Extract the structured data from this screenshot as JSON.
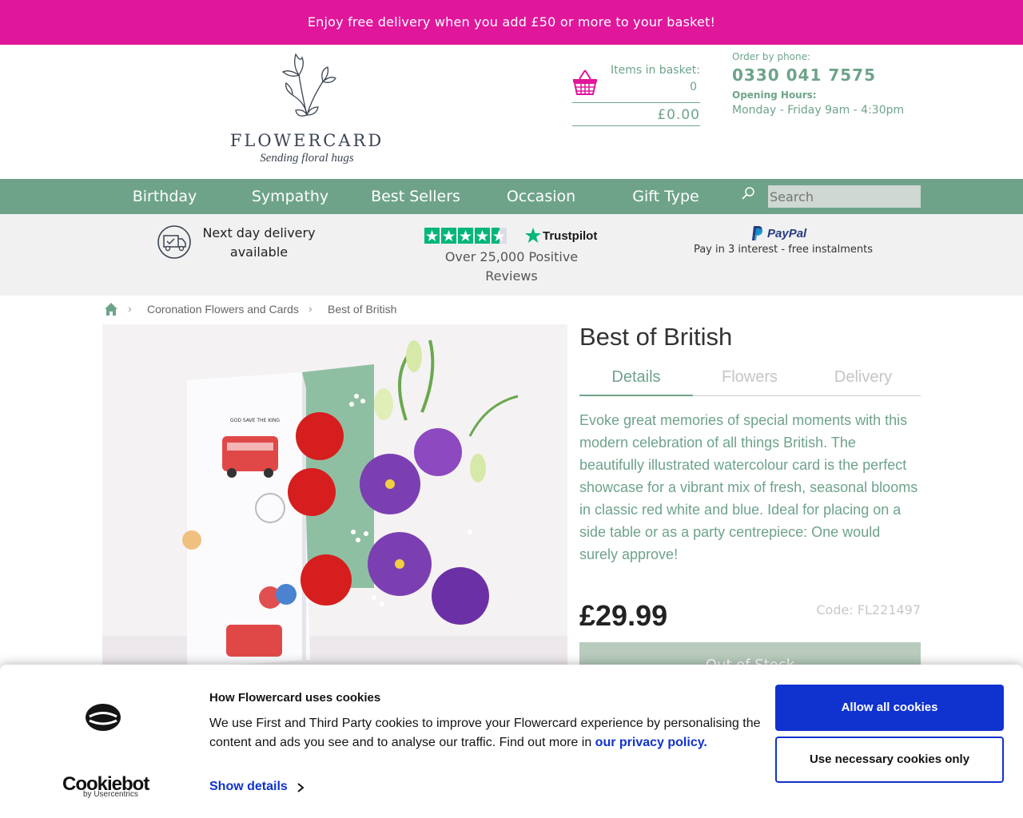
{
  "promo_bar": {
    "text": "Enjoy free delivery when you add £50 or more to your basket!"
  },
  "logo": {
    "brand": "FLOWERCARD",
    "tagline": "Sending floral hugs"
  },
  "basket": {
    "label": "Items in basket:",
    "count": "0",
    "total": "£0.00"
  },
  "contact": {
    "order_label": "Order by phone:",
    "phone": "0330 041 7575",
    "hours_label": "Opening Hours:",
    "hours": "Monday - Friday 9am - 4:30pm"
  },
  "nav": {
    "items": [
      "Birthday",
      "Sympathy",
      "Best Sellers",
      "Occasion",
      "Gift Type"
    ],
    "search_placeholder": "Search"
  },
  "trust": {
    "delivery": "Next day delivery available",
    "trustpilot_brand": "Trustpilot",
    "reviews": "Over 25,000 Positive Reviews",
    "paypal_brand": "PayPal",
    "paypal_text": "Pay in 3 interest - free instalments"
  },
  "breadcrumb": {
    "items": [
      "Coronation Flowers and Cards",
      "Best of British"
    ]
  },
  "product": {
    "title": "Best of British",
    "tabs": [
      "Details",
      "Flowers",
      "Delivery"
    ],
    "description": "Evoke great memories of special moments with this modern celebration of all things British. The beautifully illustrated watercolour card is the perfect showcase for a vibrant mix of fresh, seasonal blooms in classic red white and blue. Ideal for placing on a side table or as a party centrepiece: One would surely approve!",
    "price": "£29.99",
    "code": "Code: FL221497",
    "stock_button": "Out of Stock",
    "card_text": "GOD SAVE THE KING"
  },
  "cookie_banner": {
    "title": "How Flowercard uses cookies",
    "body": "We use First and Third Party cookies to improve your Flowercard experience by personalising the content and ads you see and to analyse our traffic. Find out more in",
    "link": "our privacy policy.",
    "show_details": "Show details",
    "allow_all": "Allow all cookies",
    "necessary_only": "Use necessary cookies only",
    "brand": "Cookiebot",
    "brand_sub": "by Usercentrics"
  },
  "colors": {
    "promo": "#e0169b",
    "brand_green": "#6ea38a",
    "cookie_blue": "#1032cf"
  }
}
